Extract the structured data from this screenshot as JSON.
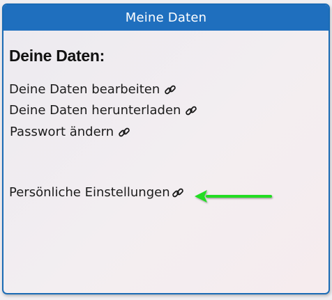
{
  "panel": {
    "title": "Meine Daten"
  },
  "section": {
    "heading": "Deine Daten:"
  },
  "links": [
    {
      "label": "Deine Daten bearbeiten",
      "icon": "link-icon"
    },
    {
      "label": "Deine Daten herunterladen",
      "icon": "link-icon"
    },
    {
      "label": "Passwort ändern",
      "icon": "link-icon"
    },
    {
      "label": "Persönliche Einstellungen",
      "icon": "link-icon"
    }
  ],
  "annotation": {
    "arrow_color": "#22dd22",
    "arrow_direction": "left"
  },
  "colors": {
    "header_bg": "#1f6fbe",
    "border": "#1a6bb5"
  }
}
